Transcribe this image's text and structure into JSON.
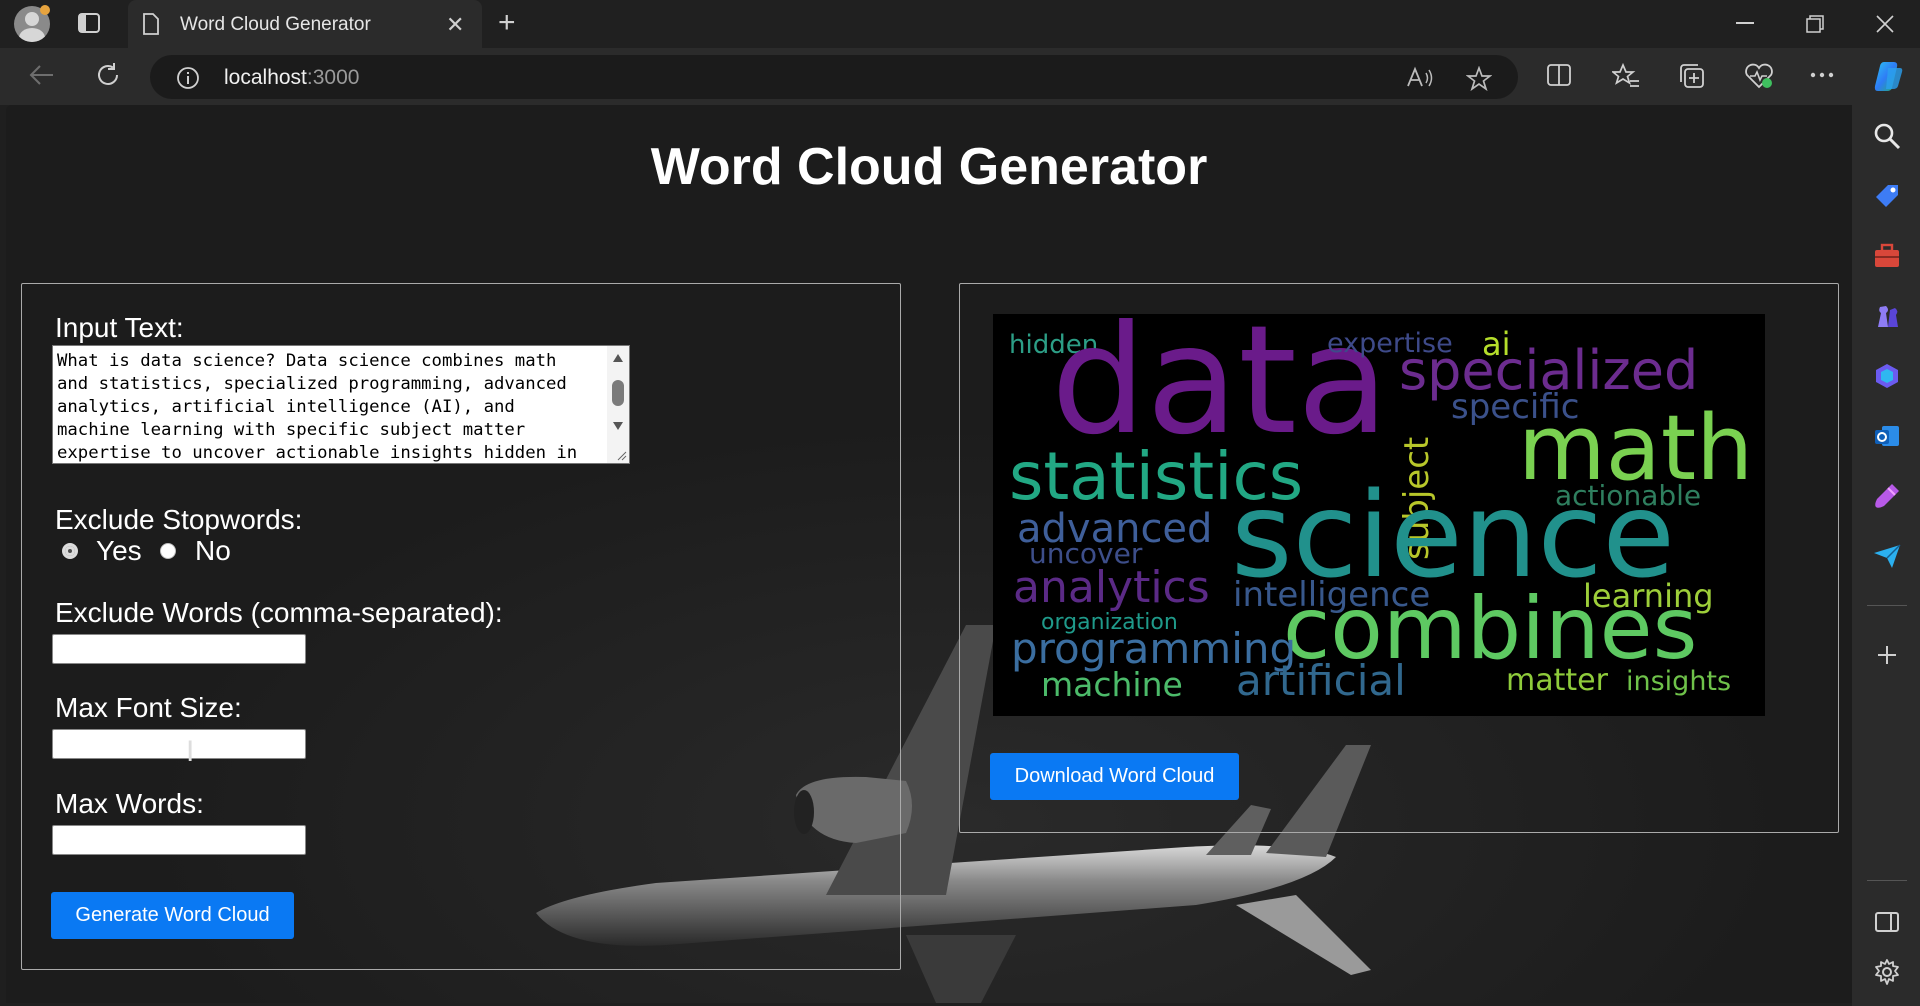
{
  "browser": {
    "tab_title": "Word Cloud Generator",
    "url_host": "localhost",
    "url_port": ":3000",
    "tab_close_glyph": "✕",
    "new_tab_glyph": "+"
  },
  "page": {
    "title": "Word Cloud Generator",
    "input_text_label": "Input Text:",
    "input_text_value": "What is data science? Data science combines math\nand statistics, specialized programming, advanced\nanalytics, artificial intelligence (AI), and\nmachine learning with specific subject matter\nexpertise to uncover actionable insights hidden in",
    "stopwords_label": "Exclude Stopwords:",
    "stopwords_options": [
      {
        "label": "Yes",
        "selected": true
      },
      {
        "label": "No",
        "selected": false
      }
    ],
    "exclude_words_label": "Exclude Words (comma-separated):",
    "exclude_words_value": "",
    "max_font_label": "Max Font Size:",
    "max_font_value": "",
    "max_words_label": "Max Words:",
    "max_words_value": "",
    "generate_button": "Generate Word Cloud",
    "download_button": "Download Word Cloud"
  },
  "word_cloud": [
    {
      "word": "data",
      "color": "#6a1b8a"
    },
    {
      "word": "science",
      "color": "#21918c"
    },
    {
      "word": "combines",
      "color": "#5ec962"
    },
    {
      "word": "math",
      "color": "#7ad151"
    },
    {
      "word": "statistics",
      "color": "#22a884"
    },
    {
      "word": "specialized",
      "color": "#6c2c8f"
    },
    {
      "word": "specific",
      "color": "#3b518b"
    },
    {
      "word": "expertise",
      "color": "#3e4a89"
    },
    {
      "word": "ai",
      "color": "#b5de2b"
    },
    {
      "word": "hidden",
      "color": "#2c9e86"
    },
    {
      "word": "subject",
      "color": "#b8c72a"
    },
    {
      "word": "actionable",
      "color": "#2f7f5f"
    },
    {
      "word": "advanced",
      "color": "#3f5f9a"
    },
    {
      "word": "uncover",
      "color": "#3d4e8a"
    },
    {
      "word": "analytics",
      "color": "#5b2a86"
    },
    {
      "word": "intelligence",
      "color": "#38588c"
    },
    {
      "word": "learning",
      "color": "#9ecf3a"
    },
    {
      "word": "organization",
      "color": "#1f9a8a"
    },
    {
      "word": "programming",
      "color": "#3b6ea0"
    },
    {
      "word": "machine",
      "color": "#4cbb6a"
    },
    {
      "word": "artificial",
      "color": "#31688e"
    },
    {
      "word": "matter",
      "color": "#8fcc3b"
    },
    {
      "word": "insights",
      "color": "#6fc24a"
    }
  ],
  "icons": {
    "sidebar": [
      "search-icon",
      "tag-icon",
      "toolbox-icon",
      "chess-icon",
      "m365-icon",
      "outlook-icon",
      "designer-icon",
      "send-icon",
      "add-icon",
      "panel-icon",
      "settings-icon"
    ],
    "accent": "#0a79f3"
  }
}
